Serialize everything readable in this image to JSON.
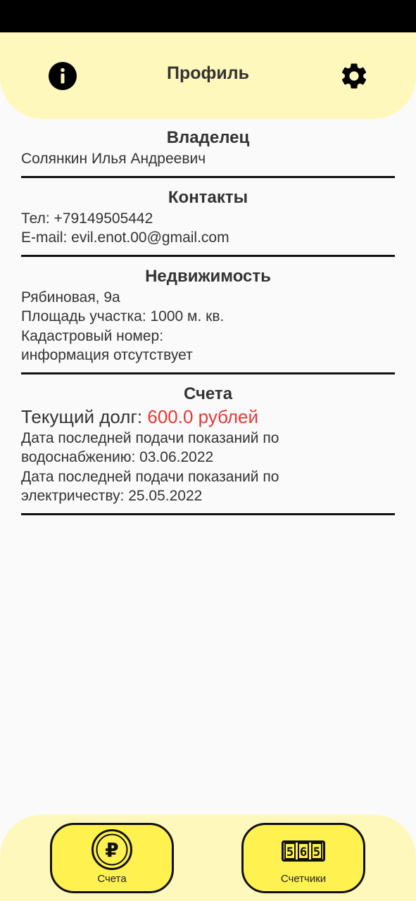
{
  "header": {
    "title": "Профиль",
    "info_icon": "info-icon",
    "settings_icon": "gear-icon"
  },
  "owner": {
    "title": "Владелец",
    "name": "Солянкин Илья Андреевич"
  },
  "contacts": {
    "title": "Контакты",
    "phone": "Тел: +79149505442",
    "email": "E-mail: evil.enot.00@gmail.com"
  },
  "property": {
    "title": "Недвижимость",
    "address": "Рябиновая, 9а",
    "area": "Площадь участка: 1000 м. кв.",
    "cadastral_label": "Кадастровый номер:",
    "cadastral_value": "информация отсутствует"
  },
  "bills": {
    "title": "Счета",
    "debt_label": "Текущий долг: ",
    "debt_value": "600.0 рублей",
    "water_line1": "Дата последней подачи показаний по",
    "water_line2": "водоснабжению: 03.06.2022",
    "electric_line1": "Дата последней подачи показаний по",
    "electric_line2": "электричеству: 25.05.2022"
  },
  "bottom_nav": {
    "bills_label": "Счета",
    "bills_icon": "ruble-coin-icon",
    "meters_label": "Счетчики",
    "meters_icon": "meter-counter-icon"
  },
  "colors": {
    "accent_light": "#fff8bd",
    "button_yellow": "#fff14f",
    "debt_red": "#e53935"
  }
}
